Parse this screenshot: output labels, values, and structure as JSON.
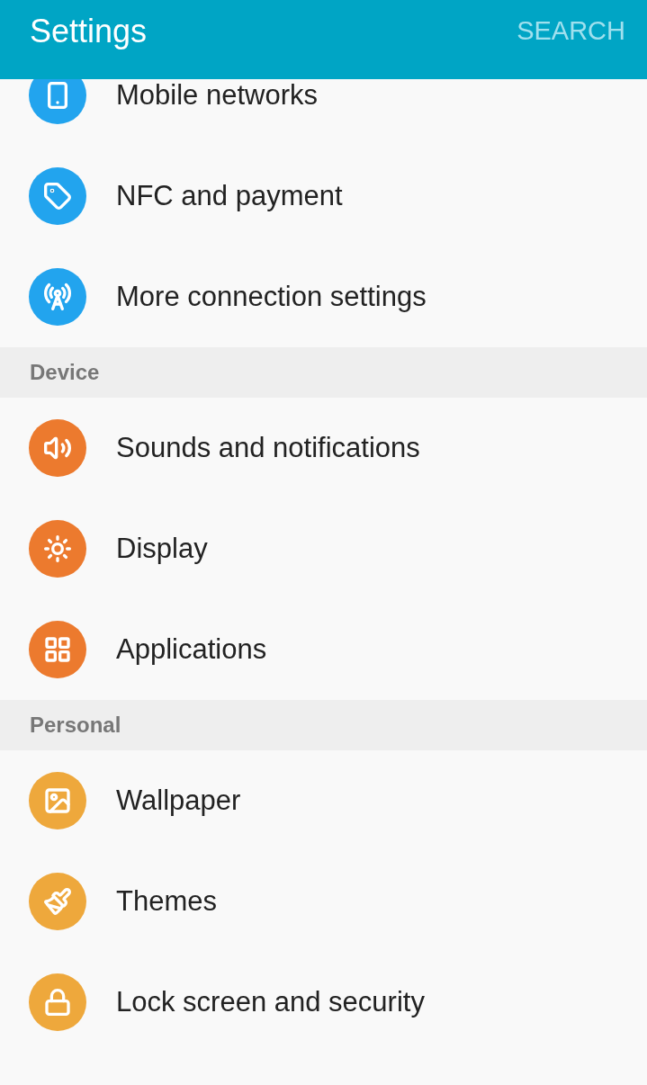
{
  "header": {
    "title": "Settings",
    "search": "SEARCH"
  },
  "sections": [
    {
      "items": [
        {
          "kind": "mobile",
          "label": "Mobile networks",
          "color": "#22a4ee"
        },
        {
          "kind": "nfc",
          "label": "NFC and payment",
          "color": "#22a4ee"
        },
        {
          "kind": "antenna",
          "label": "More connection settings",
          "color": "#22a4ee"
        }
      ]
    },
    {
      "title": "Device",
      "items": [
        {
          "kind": "sound",
          "label": "Sounds and notifications",
          "color": "#ec7a2e"
        },
        {
          "kind": "display",
          "label": "Display",
          "color": "#ec7a2e"
        },
        {
          "kind": "apps",
          "label": "Applications",
          "color": "#ec7a2e"
        }
      ]
    },
    {
      "title": "Personal",
      "items": [
        {
          "kind": "wallpaper",
          "label": "Wallpaper",
          "color": "#eea83c"
        },
        {
          "kind": "themes",
          "label": "Themes",
          "color": "#eea83c"
        },
        {
          "kind": "lock",
          "label": "Lock screen and security",
          "color": "#eea83c"
        }
      ]
    }
  ]
}
